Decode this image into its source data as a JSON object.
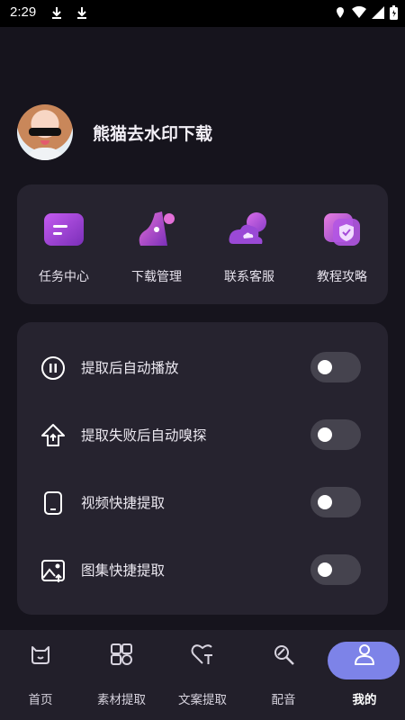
{
  "status_bar": {
    "time": "2:29"
  },
  "profile": {
    "username": "熊猫去水印下载"
  },
  "quick_actions": [
    {
      "label": "任务中心",
      "icon": "task-center-icon"
    },
    {
      "label": "下载管理",
      "icon": "download-manager-icon"
    },
    {
      "label": "联系客服",
      "icon": "customer-service-icon"
    },
    {
      "label": "教程攻略",
      "icon": "tutorial-icon"
    }
  ],
  "settings": [
    {
      "label": "提取后自动播放",
      "icon": "autoplay-icon",
      "enabled": false
    },
    {
      "label": "提取失败后自动嗅探",
      "icon": "upload-arrow-icon",
      "enabled": false
    },
    {
      "label": "视频快捷提取",
      "icon": "phone-icon",
      "enabled": false
    },
    {
      "label": "图集快捷提取",
      "icon": "image-icon",
      "enabled": false
    }
  ],
  "bottom_nav": [
    {
      "label": "首页",
      "icon": "home-icon"
    },
    {
      "label": "素材提取",
      "icon": "material-icon"
    },
    {
      "label": "文案提取",
      "icon": "text-extract-icon"
    },
    {
      "label": "配音",
      "icon": "dubbing-icon"
    },
    {
      "label": "我的",
      "icon": "profile-icon",
      "active": true
    }
  ],
  "colors": {
    "accent": "#7d83e8",
    "card": "#26232f",
    "background": "#16141d",
    "icon_purple": "#b04fe0"
  }
}
